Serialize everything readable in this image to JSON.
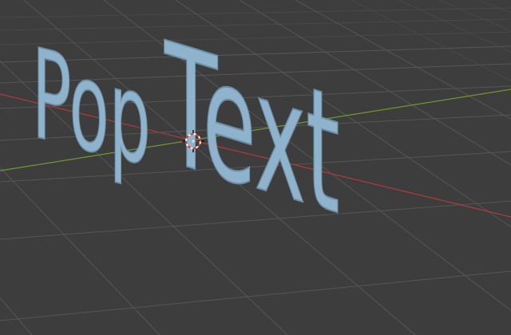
{
  "scene": {
    "background": "#3d3d3d",
    "grid_color": "#565656",
    "x_axis_color": "#b33a3a",
    "y_axis_color": "#6f9a2d",
    "text_object": {
      "text": "PopText",
      "segments": [
        "Pop",
        "Text"
      ],
      "face_color": "#8fb3cc",
      "edge_color": "#6d8fa6"
    },
    "gizmo_icon": "3d-cursor-icon"
  }
}
